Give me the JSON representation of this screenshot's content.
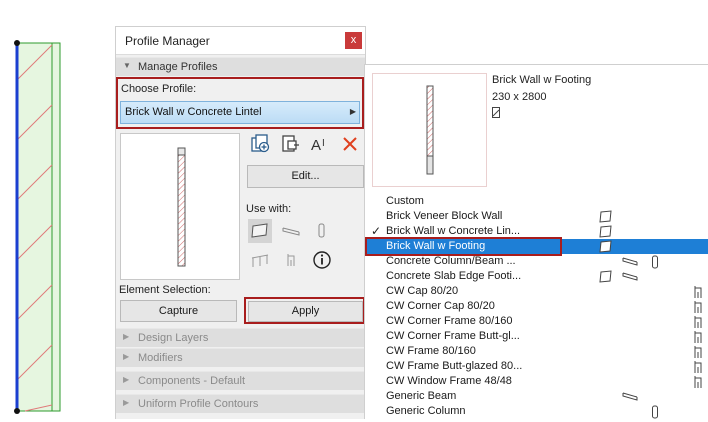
{
  "palette": {
    "title": "Profile Manager",
    "close_label": "x",
    "manage_section": "Manage Profiles",
    "choose_label": "Choose Profile:",
    "selected_profile": "Brick Wall w Concrete Lintel",
    "edit_label": "Edit...",
    "use_with_label": "Use with:",
    "element_selection_label": "Element Selection:",
    "capture_label": "Capture",
    "apply_label": "Apply",
    "tool_icons": [
      "new-profile-icon",
      "duplicate-profile-icon",
      "rename-icon",
      "delete-icon"
    ],
    "use_with_icons": [
      "wall-icon",
      "beam-icon",
      "column-icon",
      "railing-icon",
      "handrail-icon",
      "info-icon"
    ],
    "collapsed_sections": [
      "Design Layers",
      "Modifiers",
      "Components - Default",
      "Uniform Profile Contours"
    ]
  },
  "popup": {
    "preview_name": "Brick Wall w Footing",
    "preview_size": "230 x 2800",
    "items": [
      {
        "label": "Custom",
        "checked": false,
        "selected": false,
        "icons": []
      },
      {
        "label": "Brick Veneer Block Wall",
        "checked": false,
        "selected": false,
        "icons": [
          "wall"
        ]
      },
      {
        "label": "Brick Wall w Concrete Lin...",
        "checked": true,
        "selected": false,
        "icons": [
          "wall"
        ]
      },
      {
        "label": "Brick Wall w Footing",
        "checked": false,
        "selected": true,
        "icons": [
          "wall"
        ]
      },
      {
        "label": "Concrete Column/Beam ...",
        "checked": false,
        "selected": false,
        "icons": [
          "beam",
          "column"
        ]
      },
      {
        "label": "Concrete Slab Edge Footi...",
        "checked": false,
        "selected": false,
        "icons": [
          "wall",
          "beam"
        ]
      },
      {
        "label": "CW Cap 80/20",
        "checked": false,
        "selected": false,
        "icons": [
          "cw"
        ]
      },
      {
        "label": "CW Corner Cap 80/20",
        "checked": false,
        "selected": false,
        "icons": [
          "cw"
        ]
      },
      {
        "label": "CW Corner Frame 80/160",
        "checked": false,
        "selected": false,
        "icons": [
          "cw"
        ]
      },
      {
        "label": "CW Corner Frame Butt-gl...",
        "checked": false,
        "selected": false,
        "icons": [
          "cw"
        ]
      },
      {
        "label": "CW Frame 80/160",
        "checked": false,
        "selected": false,
        "icons": [
          "cw"
        ]
      },
      {
        "label": "CW Frame Butt-glazed 80...",
        "checked": false,
        "selected": false,
        "icons": [
          "cw"
        ]
      },
      {
        "label": "CW Window Frame 48/48",
        "checked": false,
        "selected": false,
        "icons": [
          "cw"
        ]
      },
      {
        "label": "Generic Beam",
        "checked": false,
        "selected": false,
        "icons": [
          "beam"
        ]
      },
      {
        "label": "Generic Column",
        "checked": false,
        "selected": false,
        "icons": [
          "column"
        ]
      }
    ]
  },
  "colors": {
    "highlight": "#a81d1d",
    "selection": "#1e7fd6",
    "wall_line": "#1a3fd0",
    "wall_fill": "#e6f6e0"
  }
}
